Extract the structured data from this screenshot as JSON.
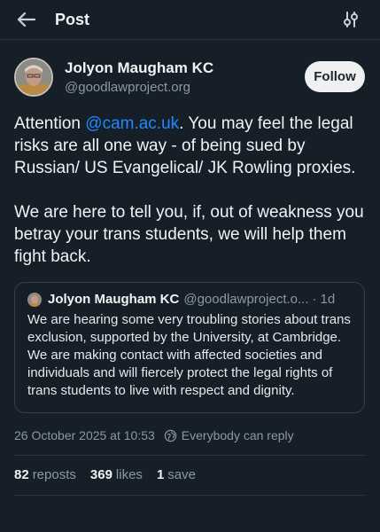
{
  "header": {
    "title": "Post",
    "back_icon": "arrow-left-icon",
    "settings_icon": "sliders-icon"
  },
  "post": {
    "author_name": "Jolyon Maugham KC",
    "author_handle": "@goodlawproject.org",
    "follow_label": "Follow",
    "text_before_mention": "Attention ",
    "mention": "@cam.ac.uk",
    "text_after_mention": ". You may feel the legal risks are all one way - of being sued by Russian/ US Evangelical/ JK Rowling proxies.",
    "paragraph2": "We are here to tell you, if, out of weakness you betray your trans students, we will help them fight back."
  },
  "quote": {
    "author_name": "Jolyon Maugham KC",
    "author_handle": "@goodlawproject.o...",
    "separator": "·",
    "time": "1d",
    "text": "We are hearing some very troubling stories about trans exclusion, supported by the University, at Cambridge. We are making contact with affected societies and individuals and will fiercely protect the legal rights of trans students to live with respect and dignity."
  },
  "meta": {
    "timestamp": "26 October 2025 at 10:53",
    "audience": "Everybody can reply"
  },
  "stats": {
    "reposts_count": "82",
    "reposts_label": "reposts",
    "likes_count": "369",
    "likes_label": "likes",
    "saves_count": "1",
    "saves_label": "save"
  },
  "colors": {
    "background": "#161e27",
    "mention": "#1e8bff",
    "muted": "#8b98a5",
    "follow_bg": "#eef0f2"
  }
}
